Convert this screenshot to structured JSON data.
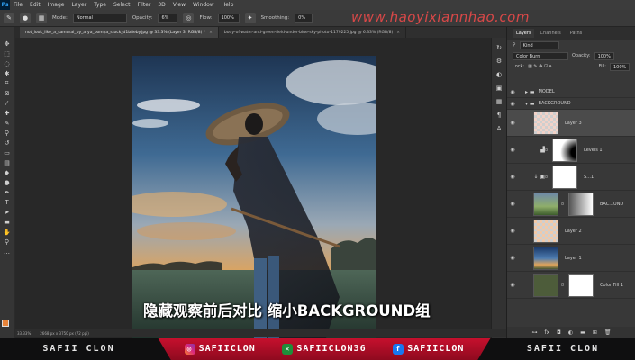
{
  "app": {
    "logo": "Ps",
    "menu": [
      "File",
      "Edit",
      "Image",
      "Layer",
      "Type",
      "Select",
      "Filter",
      "3D",
      "View",
      "Window",
      "Help"
    ]
  },
  "options_bar": {
    "mode_label": "Mode:",
    "mode_value": "Normal",
    "opacity_label": "Opacity:",
    "opacity_value": "6%",
    "flow_label": "Flow:",
    "flow_value": "100%",
    "smoothing_label": "Smoothing:",
    "smoothing_value": "0%"
  },
  "watermark": "www.haoyixiannhao.com",
  "doc_tabs": [
    {
      "label": "not_look_like_a_samurai_by_arya_pomya_stock_d1b8eby.jpg @ 33.3% (Layer 3, RGB/8) *",
      "close": "×"
    },
    {
      "label": "body-of-water-and-green-field-under-blue-sky-photo-1179225.jpg @ 6.33% (RGB/8)",
      "close": "×"
    }
  ],
  "caption": "隐藏观察前后对比 缩小BACKGROUND组",
  "status": {
    "zoom": "33.33%",
    "info": "2668 px x 3750 px (72 ppi)"
  },
  "layers_panel": {
    "tabs": [
      "Layers",
      "Channels",
      "Paths"
    ],
    "kind": "Kind",
    "blend_mode": "Color Burn",
    "opacity_label": "Opacity:",
    "opacity_value": "100%",
    "lock_label": "Lock:",
    "fill_label": "Fill:",
    "fill_value": "100%",
    "layers": [
      {
        "name": "MODEL",
        "type": "group"
      },
      {
        "name": "BACKGROUND",
        "type": "group"
      },
      {
        "name": "Layer 3",
        "type": "layer"
      },
      {
        "name": "Levels 1",
        "type": "adjustment"
      },
      {
        "name": "S...1",
        "type": "adjustment"
      },
      {
        "name": "BAC...UND",
        "type": "image"
      },
      {
        "name": "Layer 2",
        "type": "layer"
      },
      {
        "name": "Layer 1",
        "type": "layer"
      },
      {
        "name": "Color Fill 1",
        "type": "fill"
      }
    ]
  },
  "footer": {
    "left": "SAFII CLON",
    "instagram": "SAFIICLON",
    "other": "SAFIICLON36",
    "facebook": "SAFIICLON",
    "right": "SAFII CLON"
  }
}
